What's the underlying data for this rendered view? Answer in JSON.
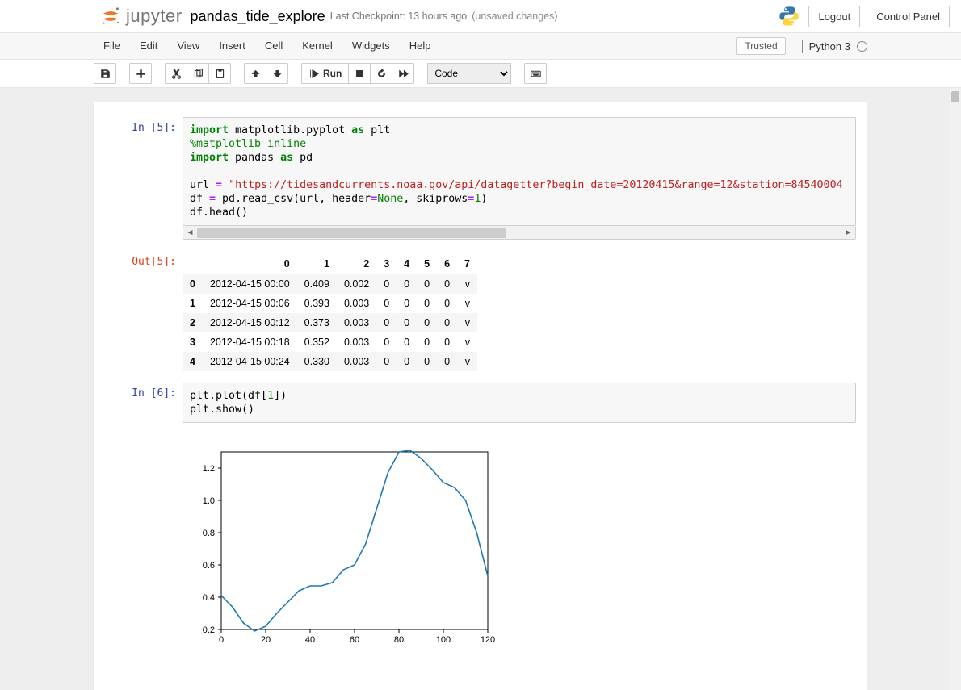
{
  "header": {
    "app_name": "jupyter",
    "notebook_name": "pandas_tide_explore",
    "checkpoint": "Last Checkpoint: 13 hours ago",
    "unsaved": "(unsaved changes)",
    "logout": "Logout",
    "control_panel": "Control Panel"
  },
  "menu": {
    "items": [
      "File",
      "Edit",
      "View",
      "Insert",
      "Cell",
      "Kernel",
      "Widgets",
      "Help"
    ],
    "trusted": "Trusted",
    "kernel": "Python 3"
  },
  "toolbar": {
    "run_label": "Run",
    "cell_type_selected": "Code"
  },
  "cells": {
    "in5_prompt": "In [5]:",
    "out5_prompt": "Out[5]:",
    "in6_prompt": "In [6]:",
    "code5": {
      "line1_a": "import",
      "line1_b": " matplotlib.pyplot ",
      "line1_c": "as",
      "line1_d": " plt",
      "line2": "%matplotlib inline",
      "line3_a": "import",
      "line3_b": " pandas ",
      "line3_c": "as",
      "line3_d": " pd",
      "line5_a": "url ",
      "line5_b": "=",
      "line5_c": " ",
      "line5_d": "\"https://tidesandcurrents.noaa.gov/api/datagetter?begin_date=20120415&range=12&station=84540004",
      "line6_a": "df ",
      "line6_b": "=",
      "line6_c": " pd.read_csv(url, header",
      "line6_d": "=",
      "line6_e": "None",
      "line6_f": ", skiprows",
      "line6_g": "=",
      "line6_h": "1",
      "line6_i": ")",
      "line7": "df.head()"
    },
    "code6": {
      "line1_a": "plt.plot(df[",
      "line1_b": "1",
      "line1_c": "])",
      "line2": "plt.show()"
    }
  },
  "table": {
    "columns": [
      "0",
      "1",
      "2",
      "3",
      "4",
      "5",
      "6",
      "7"
    ],
    "idx": [
      "0",
      "1",
      "2",
      "3",
      "4"
    ],
    "rows": [
      [
        "2012-04-15 00:00",
        "0.409",
        "0.002",
        "0",
        "0",
        "0",
        "0",
        "v"
      ],
      [
        "2012-04-15 00:06",
        "0.393",
        "0.003",
        "0",
        "0",
        "0",
        "0",
        "v"
      ],
      [
        "2012-04-15 00:12",
        "0.373",
        "0.003",
        "0",
        "0",
        "0",
        "0",
        "v"
      ],
      [
        "2012-04-15 00:18",
        "0.352",
        "0.003",
        "0",
        "0",
        "0",
        "0",
        "v"
      ],
      [
        "2012-04-15 00:24",
        "0.330",
        "0.003",
        "0",
        "0",
        "0",
        "0",
        "v"
      ]
    ]
  },
  "chart_data": {
    "type": "line",
    "title": "",
    "xlabel": "",
    "ylabel": "",
    "xlim": [
      0,
      120
    ],
    "ylim": [
      0.2,
      1.3
    ],
    "xticks": [
      0,
      20,
      40,
      60,
      80,
      100,
      120
    ],
    "yticks": [
      0.2,
      0.4,
      0.6,
      0.8,
      1.0,
      1.2
    ],
    "series": [
      {
        "name": "df[1]",
        "color": "#1f77b4",
        "x": [
          0,
          5,
          10,
          15,
          20,
          25,
          30,
          35,
          40,
          45,
          50,
          55,
          60,
          65,
          70,
          75,
          80,
          85,
          90,
          95,
          100,
          105,
          110,
          115,
          120
        ],
        "values": [
          0.41,
          0.34,
          0.24,
          0.19,
          0.22,
          0.3,
          0.37,
          0.44,
          0.47,
          0.47,
          0.49,
          0.57,
          0.6,
          0.73,
          0.95,
          1.17,
          1.3,
          1.31,
          1.26,
          1.19,
          1.11,
          1.08,
          1.0,
          0.8,
          0.53
        ]
      }
    ]
  }
}
